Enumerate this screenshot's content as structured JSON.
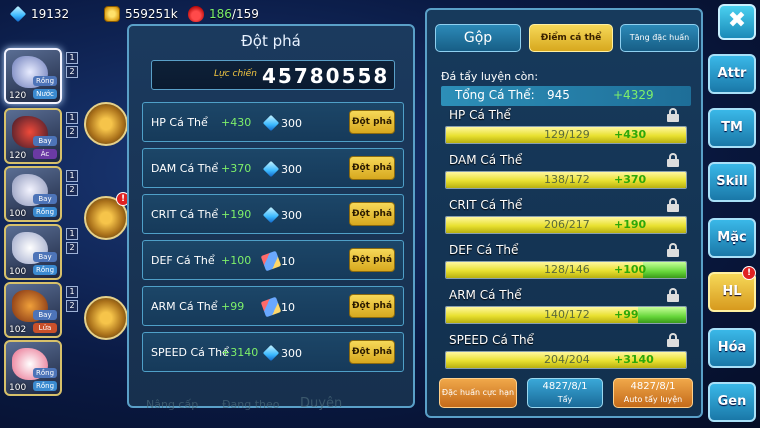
{
  "resources": {
    "gems": "19132",
    "gold": "559251k",
    "energy_current": "186",
    "energy_max": "/159"
  },
  "roster": [
    {
      "level": "120",
      "tag1": "Rồng",
      "tag2": "Nước",
      "slot": "1",
      "slot2": "2"
    },
    {
      "level": "120",
      "tag1": "Bay",
      "tag2": "Ác",
      "slot": "1",
      "slot2": "2"
    },
    {
      "level": "100",
      "tag1": "Bay",
      "tag2": "Rồng",
      "slot": "1",
      "slot2": "2"
    },
    {
      "level": "100",
      "tag1": "Bay",
      "tag2": "Rồng",
      "slot": "1",
      "slot2": "2"
    },
    {
      "level": "102",
      "tag1": "Bay",
      "tag2": "Lửa",
      "slot": "1",
      "slot2": "2"
    },
    {
      "level": "100",
      "tag1": "Rồng",
      "tag2": "Rồng",
      "slot": "1",
      "slot2": "2"
    }
  ],
  "breakthrough": {
    "title": "Đột phá",
    "power_label": "Lực chiến",
    "power_value": "45780558",
    "rows": [
      {
        "name": "HP Cá Thể",
        "plus": "+430",
        "cost_icon": "diamond-icon",
        "cost": "300",
        "button": "Đột phá"
      },
      {
        "name": "DAM Cá Thể",
        "plus": "+370",
        "cost_icon": "diamond-icon",
        "cost": "300",
        "button": "Đột phá"
      },
      {
        "name": "CRIT Cá Thể",
        "plus": "+190",
        "cost_icon": "diamond-icon",
        "cost": "300",
        "button": "Đột phá"
      },
      {
        "name": "DEF Cá Thể",
        "plus": "+100",
        "cost_icon": "scroll-icon",
        "cost": "10",
        "button": "Đột phá"
      },
      {
        "name": "ARM Cá Thể",
        "plus": "+99",
        "cost_icon": "scroll-icon",
        "cost": "10",
        "button": "Đột phá"
      },
      {
        "name": "SPEED Cá Thể",
        "plus": "+3140",
        "cost_icon": "diamond-icon",
        "cost": "300",
        "button": "Đột phá"
      }
    ],
    "bottom_tabs": [
      "Nâng cấp",
      "Đang theo",
      "Duyên"
    ]
  },
  "stats_panel": {
    "tabs": [
      "Gộp",
      "Điểm cá thể",
      "Tăng đặc huấn"
    ],
    "heading": "Đá tẩy luyện còn:",
    "total_label": "Tổng Cá Thể:",
    "total_value": "945",
    "total_bonus": "+4329",
    "stats": [
      {
        "name": "HP Cá Thể",
        "ratio": "129/129",
        "plus": "+430",
        "fill": 1.0,
        "bonus_from": 1.0,
        "bonus_to": 1.0
      },
      {
        "name": "DAM Cá Thể",
        "ratio": "138/172",
        "plus": "+370",
        "fill": 1.0,
        "bonus_from": 1.0,
        "bonus_to": 1.0
      },
      {
        "name": "CRIT Cá Thể",
        "ratio": "206/217",
        "plus": "+190",
        "fill": 1.0,
        "bonus_from": 1.0,
        "bonus_to": 1.0
      },
      {
        "name": "DEF Cá Thể",
        "ratio": "128/146",
        "plus": "+100",
        "fill": 0.82,
        "bonus_from": 0.82,
        "bonus_to": 1.0
      },
      {
        "name": "ARM Cá Thể",
        "ratio": "140/172",
        "plus": "+99",
        "fill": 0.8,
        "bonus_from": 0.8,
        "bonus_to": 1.0
      },
      {
        "name": "SPEED Cá Thể",
        "ratio": "204/204",
        "plus": "+3140",
        "fill": 1.0,
        "bonus_from": 1.0,
        "bonus_to": 1.0
      }
    ],
    "actions": {
      "special_label": "Đặc huấn cực hạn",
      "wash_count": "4827/8/1",
      "wash_label": "Tẩy",
      "auto_count": "4827/8/1",
      "auto_label": "Auto tẩy luyện"
    }
  },
  "side_menu": {
    "close": "✖",
    "items": [
      "Attr",
      "TM",
      "Skill",
      "Mặc",
      "HL",
      "Hóa",
      "Gen"
    ],
    "active": "HL",
    "hl_notif": "!"
  },
  "colors": {
    "accent_yellow": "#f6d858",
    "bonus_green": "#7ef06a",
    "panel_border": "#5aa0c8"
  }
}
